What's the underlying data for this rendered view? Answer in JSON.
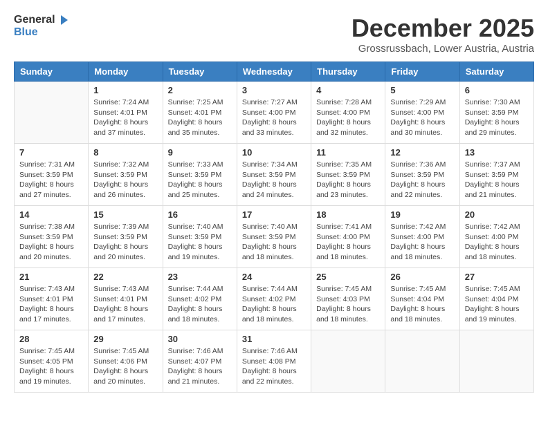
{
  "logo": {
    "general": "General",
    "blue": "Blue"
  },
  "title": "December 2025",
  "location": "Grossrussbach, Lower Austria, Austria",
  "weekdays": [
    "Sunday",
    "Monday",
    "Tuesday",
    "Wednesday",
    "Thursday",
    "Friday",
    "Saturday"
  ],
  "weeks": [
    [
      {
        "day": "",
        "sunrise": "",
        "sunset": "",
        "daylight": ""
      },
      {
        "day": "1",
        "sunrise": "Sunrise: 7:24 AM",
        "sunset": "Sunset: 4:01 PM",
        "daylight": "Daylight: 8 hours and 37 minutes."
      },
      {
        "day": "2",
        "sunrise": "Sunrise: 7:25 AM",
        "sunset": "Sunset: 4:01 PM",
        "daylight": "Daylight: 8 hours and 35 minutes."
      },
      {
        "day": "3",
        "sunrise": "Sunrise: 7:27 AM",
        "sunset": "Sunset: 4:00 PM",
        "daylight": "Daylight: 8 hours and 33 minutes."
      },
      {
        "day": "4",
        "sunrise": "Sunrise: 7:28 AM",
        "sunset": "Sunset: 4:00 PM",
        "daylight": "Daylight: 8 hours and 32 minutes."
      },
      {
        "day": "5",
        "sunrise": "Sunrise: 7:29 AM",
        "sunset": "Sunset: 4:00 PM",
        "daylight": "Daylight: 8 hours and 30 minutes."
      },
      {
        "day": "6",
        "sunrise": "Sunrise: 7:30 AM",
        "sunset": "Sunset: 3:59 PM",
        "daylight": "Daylight: 8 hours and 29 minutes."
      }
    ],
    [
      {
        "day": "7",
        "sunrise": "Sunrise: 7:31 AM",
        "sunset": "Sunset: 3:59 PM",
        "daylight": "Daylight: 8 hours and 27 minutes."
      },
      {
        "day": "8",
        "sunrise": "Sunrise: 7:32 AM",
        "sunset": "Sunset: 3:59 PM",
        "daylight": "Daylight: 8 hours and 26 minutes."
      },
      {
        "day": "9",
        "sunrise": "Sunrise: 7:33 AM",
        "sunset": "Sunset: 3:59 PM",
        "daylight": "Daylight: 8 hours and 25 minutes."
      },
      {
        "day": "10",
        "sunrise": "Sunrise: 7:34 AM",
        "sunset": "Sunset: 3:59 PM",
        "daylight": "Daylight: 8 hours and 24 minutes."
      },
      {
        "day": "11",
        "sunrise": "Sunrise: 7:35 AM",
        "sunset": "Sunset: 3:59 PM",
        "daylight": "Daylight: 8 hours and 23 minutes."
      },
      {
        "day": "12",
        "sunrise": "Sunrise: 7:36 AM",
        "sunset": "Sunset: 3:59 PM",
        "daylight": "Daylight: 8 hours and 22 minutes."
      },
      {
        "day": "13",
        "sunrise": "Sunrise: 7:37 AM",
        "sunset": "Sunset: 3:59 PM",
        "daylight": "Daylight: 8 hours and 21 minutes."
      }
    ],
    [
      {
        "day": "14",
        "sunrise": "Sunrise: 7:38 AM",
        "sunset": "Sunset: 3:59 PM",
        "daylight": "Daylight: 8 hours and 20 minutes."
      },
      {
        "day": "15",
        "sunrise": "Sunrise: 7:39 AM",
        "sunset": "Sunset: 3:59 PM",
        "daylight": "Daylight: 8 hours and 20 minutes."
      },
      {
        "day": "16",
        "sunrise": "Sunrise: 7:40 AM",
        "sunset": "Sunset: 3:59 PM",
        "daylight": "Daylight: 8 hours and 19 minutes."
      },
      {
        "day": "17",
        "sunrise": "Sunrise: 7:40 AM",
        "sunset": "Sunset: 3:59 PM",
        "daylight": "Daylight: 8 hours and 18 minutes."
      },
      {
        "day": "18",
        "sunrise": "Sunrise: 7:41 AM",
        "sunset": "Sunset: 4:00 PM",
        "daylight": "Daylight: 8 hours and 18 minutes."
      },
      {
        "day": "19",
        "sunrise": "Sunrise: 7:42 AM",
        "sunset": "Sunset: 4:00 PM",
        "daylight": "Daylight: 8 hours and 18 minutes."
      },
      {
        "day": "20",
        "sunrise": "Sunrise: 7:42 AM",
        "sunset": "Sunset: 4:00 PM",
        "daylight": "Daylight: 8 hours and 18 minutes."
      }
    ],
    [
      {
        "day": "21",
        "sunrise": "Sunrise: 7:43 AM",
        "sunset": "Sunset: 4:01 PM",
        "daylight": "Daylight: 8 hours and 17 minutes."
      },
      {
        "day": "22",
        "sunrise": "Sunrise: 7:43 AM",
        "sunset": "Sunset: 4:01 PM",
        "daylight": "Daylight: 8 hours and 17 minutes."
      },
      {
        "day": "23",
        "sunrise": "Sunrise: 7:44 AM",
        "sunset": "Sunset: 4:02 PM",
        "daylight": "Daylight: 8 hours and 18 minutes."
      },
      {
        "day": "24",
        "sunrise": "Sunrise: 7:44 AM",
        "sunset": "Sunset: 4:02 PM",
        "daylight": "Daylight: 8 hours and 18 minutes."
      },
      {
        "day": "25",
        "sunrise": "Sunrise: 7:45 AM",
        "sunset": "Sunset: 4:03 PM",
        "daylight": "Daylight: 8 hours and 18 minutes."
      },
      {
        "day": "26",
        "sunrise": "Sunrise: 7:45 AM",
        "sunset": "Sunset: 4:04 PM",
        "daylight": "Daylight: 8 hours and 18 minutes."
      },
      {
        "day": "27",
        "sunrise": "Sunrise: 7:45 AM",
        "sunset": "Sunset: 4:04 PM",
        "daylight": "Daylight: 8 hours and 19 minutes."
      }
    ],
    [
      {
        "day": "28",
        "sunrise": "Sunrise: 7:45 AM",
        "sunset": "Sunset: 4:05 PM",
        "daylight": "Daylight: 8 hours and 19 minutes."
      },
      {
        "day": "29",
        "sunrise": "Sunrise: 7:45 AM",
        "sunset": "Sunset: 4:06 PM",
        "daylight": "Daylight: 8 hours and 20 minutes."
      },
      {
        "day": "30",
        "sunrise": "Sunrise: 7:46 AM",
        "sunset": "Sunset: 4:07 PM",
        "daylight": "Daylight: 8 hours and 21 minutes."
      },
      {
        "day": "31",
        "sunrise": "Sunrise: 7:46 AM",
        "sunset": "Sunset: 4:08 PM",
        "daylight": "Daylight: 8 hours and 22 minutes."
      },
      {
        "day": "",
        "sunrise": "",
        "sunset": "",
        "daylight": ""
      },
      {
        "day": "",
        "sunrise": "",
        "sunset": "",
        "daylight": ""
      },
      {
        "day": "",
        "sunrise": "",
        "sunset": "",
        "daylight": ""
      }
    ]
  ]
}
